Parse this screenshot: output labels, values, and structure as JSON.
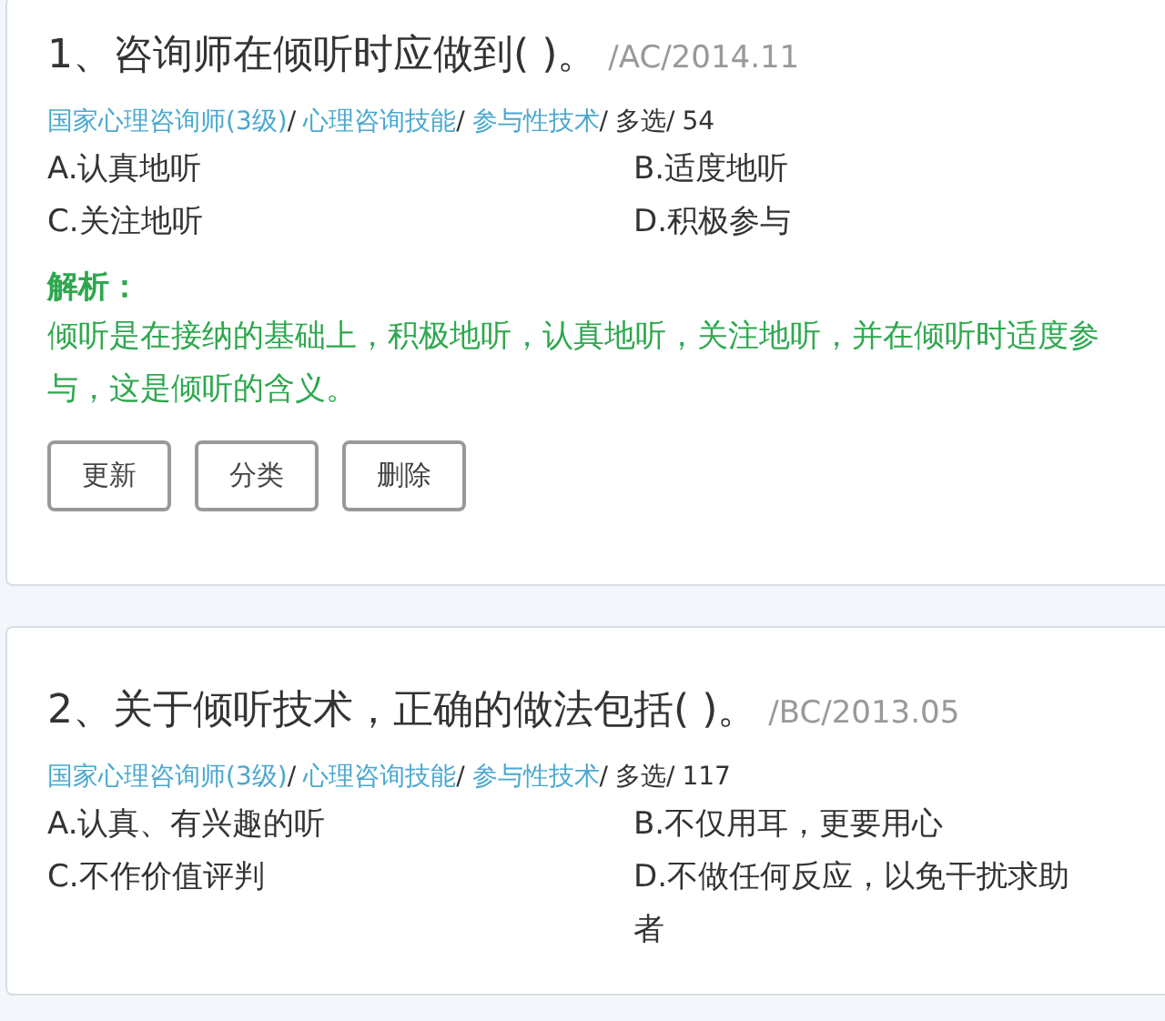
{
  "separator": "/",
  "questions": [
    {
      "title": "1、咨询师在倾听时应做到( )。",
      "source": "/AC/2014.11",
      "path": [
        "国家心理咨询师(3级)",
        "心理咨询技能",
        "参与性技术"
      ],
      "type": "多选",
      "count": "54",
      "options": [
        "A.认真地听",
        "B.适度地听",
        "C.关注地听",
        "D.积极参与"
      ],
      "analysis_label": "解析：",
      "analysis": "倾听是在接纳的基础上，积极地听，认真地听，关注地听，并在倾听时适度参与，这是倾听的含义。",
      "buttons": [
        "更新",
        "分类",
        "删除"
      ]
    },
    {
      "title": "2、关于倾听技术，正确的做法包括( )。",
      "source": "/BC/2013.05",
      "path": [
        "国家心理咨询师(3级)",
        "心理咨询技能",
        "参与性技术"
      ],
      "type": "多选",
      "count": "117",
      "options": [
        "A.认真、有兴趣的听",
        "B.不仅用耳，更要用心",
        "C.不作价值评判",
        "D.不做任何反应，以免干扰求助者"
      ]
    }
  ]
}
